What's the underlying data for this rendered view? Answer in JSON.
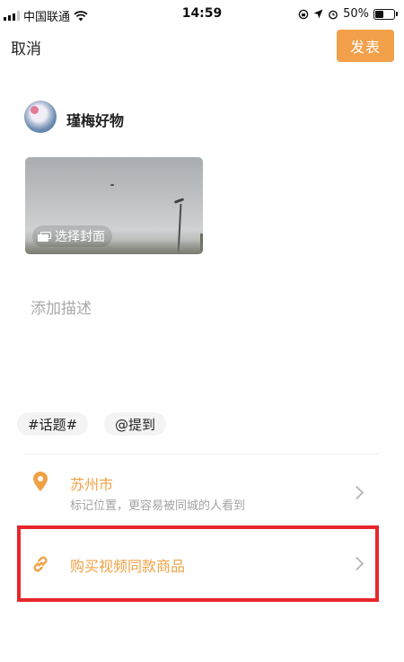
{
  "status_bar": {
    "carrier": "中国联通",
    "time": "14:59",
    "battery_percent": "50%",
    "battery_level": 0.5
  },
  "header": {
    "cancel_label": "取消",
    "publish_label": "发表"
  },
  "user": {
    "name": "瑾梅好物"
  },
  "cover": {
    "select_label": "选择封面"
  },
  "description": {
    "placeholder": "添加描述"
  },
  "tags": {
    "topic_label": "#话题#",
    "mention_label": "@提到"
  },
  "location": {
    "city": "苏州市",
    "hint": "标记位置，更容易被同城的人看到"
  },
  "product": {
    "label": "购买视频同款商品"
  },
  "colors": {
    "accent": "#f0a144",
    "publish_bg": "#f2a04a",
    "highlight": "#e8252a"
  },
  "icons": {
    "location": "map-pin-icon",
    "product": "link-icon",
    "cover": "image-stack-icon",
    "row_arrow": "chevron-right-icon"
  }
}
